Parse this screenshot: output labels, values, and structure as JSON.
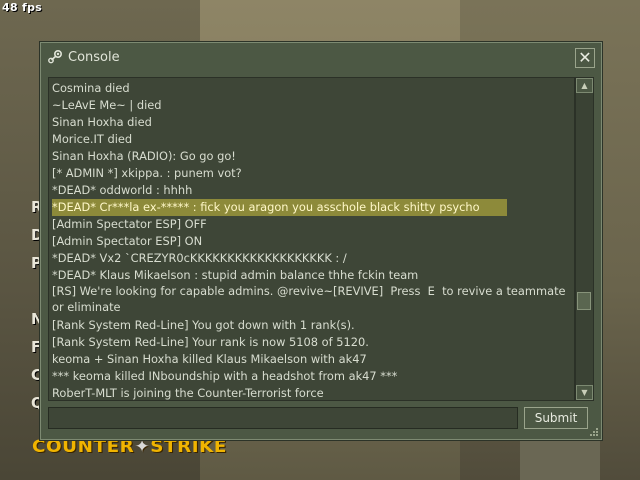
{
  "hud": {
    "fps": "48 fps",
    "menu_letters": [
      "R",
      "D",
      "P",
      "N",
      "F",
      "C",
      "Q"
    ],
    "logo_left": "Counter",
    "logo_right": "Strike"
  },
  "console": {
    "title": "Console",
    "icon": "steam-icon",
    "close_icon": "close-icon",
    "close_glyph": "✕",
    "lines": [
      "Cosmina died",
      "~LeAvE Me~ | died",
      "Sinan Hoxha died",
      "Morice.IT died",
      "Sinan Hoxha (RADIO): Go go go!",
      "[* ADMIN *] xkippa. : punem vot?",
      "*DEAD* oddworld : hhhh",
      "*DEAD* Cr***la ex-***** : fick you aragon you asschole black shitty psycho",
      "[Admin Spectator ESP] OFF",
      "[Admin Spectator ESP] ON",
      "*DEAD* Vx2 `CREZYR0cKKKKKKKKKKKKKKKKKKK : /",
      "*DEAD* Klaus Mikaelson : stupid admin balance thhe fckin team",
      "[RS] We're looking for capable admins. @revive~[REVIVE]  Press  E  to revive a teammate or eliminate",
      "[Rank System Red-Line] You got down with 1 rank(s).",
      "[Rank System Red-Line] Your rank is now 5108 of 5120.",
      "keoma + Sinan Hoxha killed Klaus Mikaelson with ak47",
      "*** keoma killed INboundship with a headshot from ak47 ***",
      "RoberT-MLT is joining the Counter-Terrorist force"
    ],
    "highlighted_line_index": 7,
    "input": {
      "value": "",
      "placeholder": ""
    },
    "submit_label": "Submit",
    "scroll_up_glyph": "▲",
    "scroll_down_glyph": "▼",
    "scroll_position": 0.92
  },
  "colors": {
    "console_bg": "#4c5844",
    "log_bg": "#3e4637",
    "highlight": "#8d8a3a",
    "logo": "#f0b400"
  }
}
